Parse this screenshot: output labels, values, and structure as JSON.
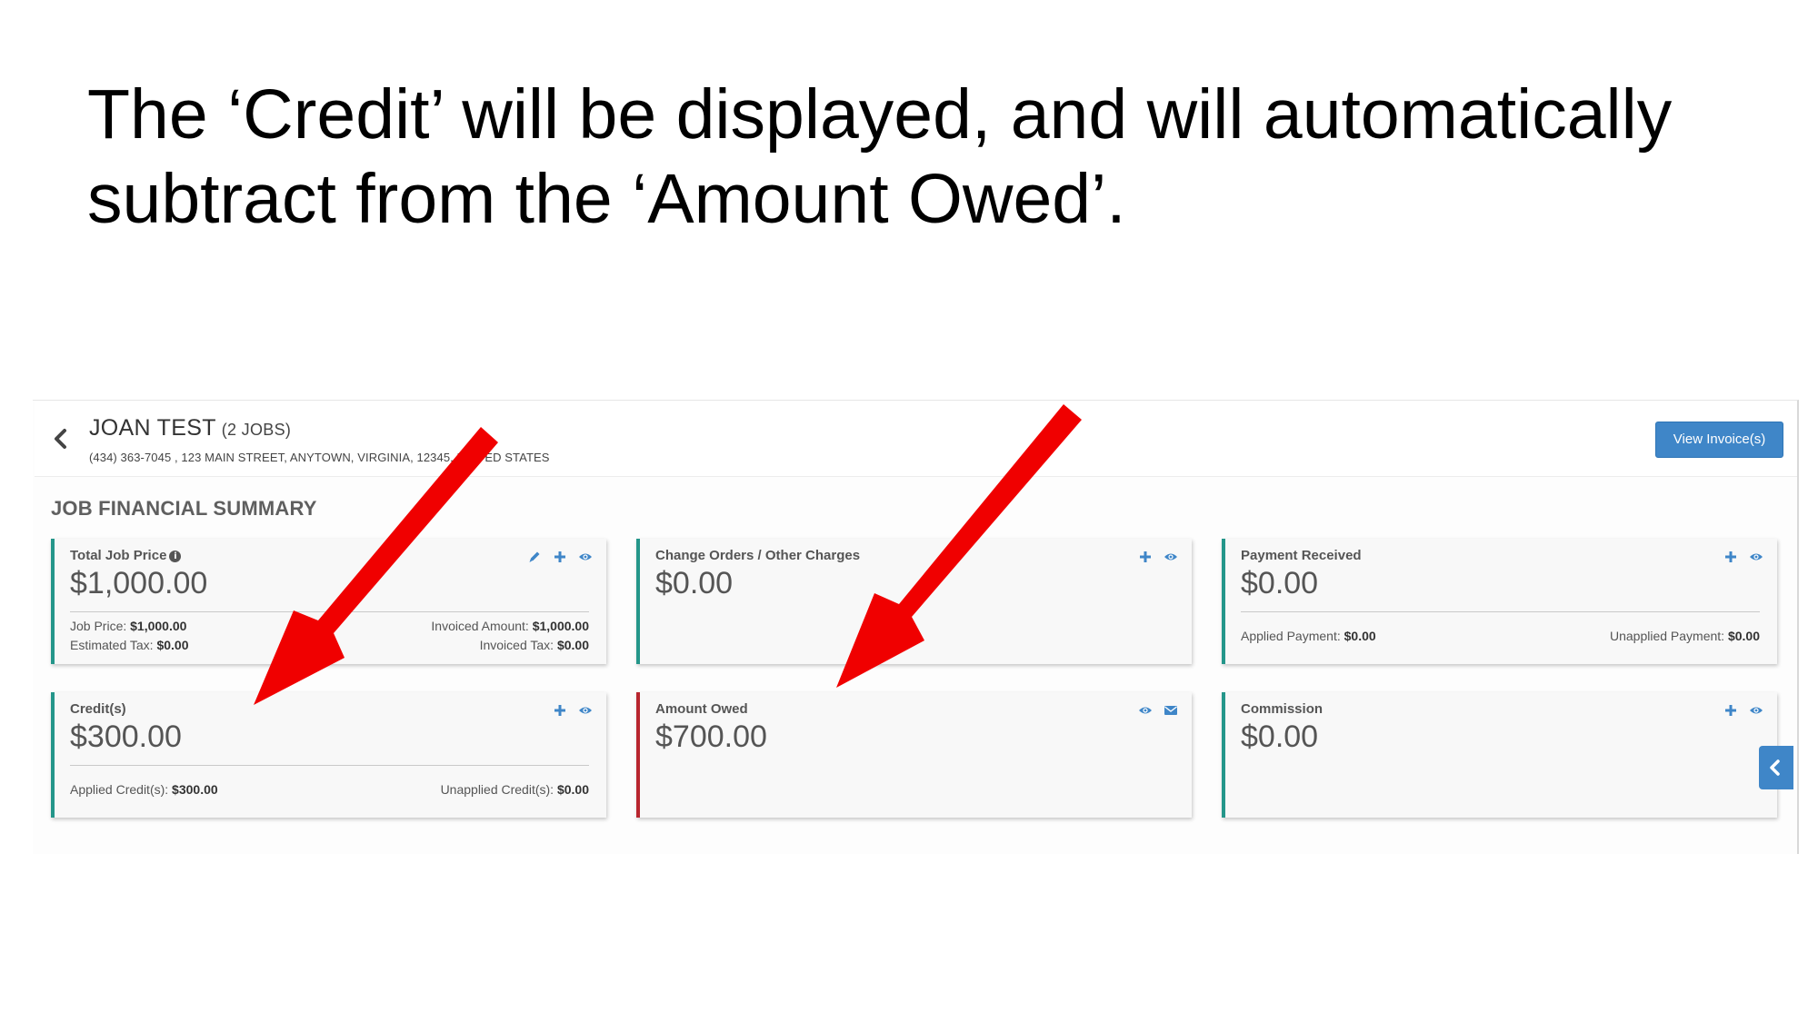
{
  "slide": {
    "title_line1": "The ‘Credit’ will be displayed, and will automatically",
    "title_line2": "subtract from the ‘Amount Owed’."
  },
  "header": {
    "customer_name": "JOAN TEST",
    "jobs_count": "(2 JOBS)",
    "address": "(434) 363-7045 , 123 MAIN STREET, ANYTOWN, VIRGINIA, 12345, UNITED STATES",
    "view_invoices_label": "View Invoice(s)"
  },
  "summary": {
    "title": "JOB FINANCIAL SUMMARY",
    "total_job_price": {
      "label": "Total Job Price",
      "value": "$1,000.00",
      "job_price_label": "Job Price:",
      "job_price_value": "$1,000.00",
      "estimated_tax_label": "Estimated Tax:",
      "estimated_tax_value": "$0.00",
      "invoiced_amount_label": "Invoiced Amount:",
      "invoiced_amount_value": "$1,000.00",
      "invoiced_tax_label": "Invoiced Tax:",
      "invoiced_tax_value": "$0.00"
    },
    "change_orders": {
      "label": "Change Orders / Other Charges",
      "value": "$0.00"
    },
    "payment_received": {
      "label": "Payment Received",
      "value": "$0.00",
      "applied_label": "Applied Payment:",
      "applied_value": "$0.00",
      "unapplied_label": "Unapplied Payment:",
      "unapplied_value": "$0.00"
    },
    "credits": {
      "label": "Credit(s)",
      "value": "$300.00",
      "applied_label": "Applied Credit(s):",
      "applied_value": "$300.00",
      "unapplied_label": "Unapplied Credit(s):",
      "unapplied_value": "$0.00"
    },
    "amount_owed": {
      "label": "Amount Owed",
      "value": "$700.00"
    },
    "commission": {
      "label": "Commission",
      "value": "$0.00"
    }
  },
  "colors": {
    "accent_blue": "#3f86c8",
    "card_green": "#24968a",
    "card_red": "#b8262f",
    "annotation_arrow": "#f00000"
  },
  "icons": [
    "chevron-left-icon",
    "info-icon",
    "pencil-icon",
    "plus-icon",
    "eye-icon",
    "envelope-icon",
    "chevron-left-icon"
  ]
}
